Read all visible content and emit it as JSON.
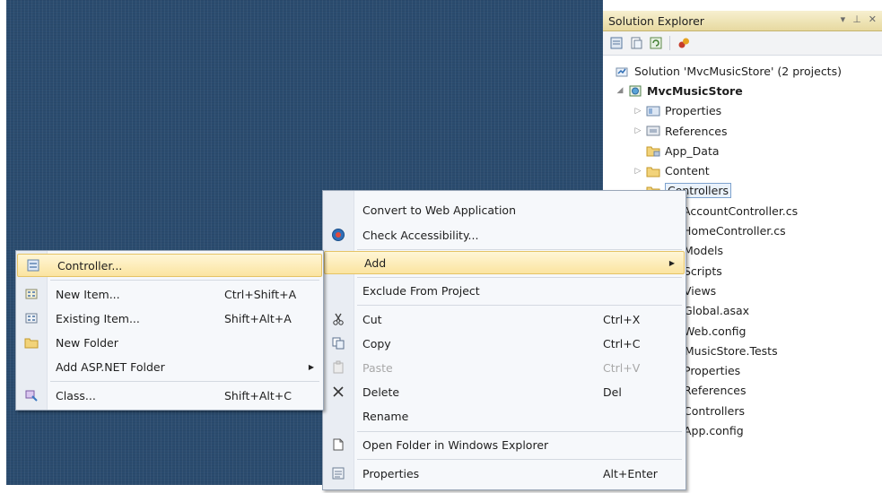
{
  "solution_explorer": {
    "title": "Solution Explorer",
    "title_controls": [
      "▾",
      "⊥",
      "✕"
    ],
    "tree": [
      {
        "label": "Solution 'MvcMusicStore' (2 projects)",
        "icon": "solution-icon"
      },
      {
        "label": "MvcMusicStore",
        "icon": "web-project-icon"
      },
      {
        "label": "Properties",
        "icon": "properties-icon"
      },
      {
        "label": "References",
        "icon": "references-icon"
      },
      {
        "label": "App_Data",
        "icon": "folder-icon"
      },
      {
        "label": "Content",
        "icon": "folder-icon"
      },
      {
        "label": "Controllers",
        "icon": "folder-icon"
      },
      {
        "label": "AccountController.cs",
        "icon": "csharp-file-icon"
      },
      {
        "label": "HomeController.cs",
        "icon": "csharp-file-icon"
      },
      {
        "label": "Models"
      },
      {
        "label": "Scripts"
      },
      {
        "label": "Views"
      },
      {
        "label": "Global.asax"
      },
      {
        "label": "Web.config"
      },
      {
        "label": "cMusicStore.Tests"
      },
      {
        "label": "Properties"
      },
      {
        "label": "References"
      },
      {
        "label": "Controllers"
      },
      {
        "label": "App.config"
      }
    ]
  },
  "context_menu": {
    "items": [
      {
        "label": "Convert to Web Application",
        "shortcut": ""
      },
      {
        "label": "Check Accessibility...",
        "shortcut": "",
        "icon": "accessibility-icon"
      },
      {
        "label": "Add",
        "shortcut": "",
        "submenu": true
      },
      {
        "label": "Exclude From Project",
        "shortcut": ""
      },
      {
        "label": "Cut",
        "shortcut": "Ctrl+X",
        "icon": "scissors-icon"
      },
      {
        "label": "Copy",
        "shortcut": "Ctrl+C",
        "icon": "copy-icon"
      },
      {
        "label": "Paste",
        "shortcut": "Ctrl+V",
        "icon": "paste-icon",
        "disabled": true
      },
      {
        "label": "Delete",
        "shortcut": "Del",
        "icon": "delete-icon"
      },
      {
        "label": "Rename",
        "shortcut": ""
      },
      {
        "label": "Open Folder in Windows Explorer",
        "shortcut": "",
        "icon": "open-folder-icon"
      },
      {
        "label": "Properties",
        "shortcut": "Alt+Enter",
        "icon": "properties-icon"
      }
    ]
  },
  "add_submenu": {
    "items": [
      {
        "label": "Controller...",
        "shortcut": "",
        "icon": "controller-icon"
      },
      {
        "label": "New Item...",
        "shortcut": "Ctrl+Shift+A",
        "icon": "new-item-icon"
      },
      {
        "label": "Existing Item...",
        "shortcut": "Shift+Alt+A",
        "icon": "existing-item-icon"
      },
      {
        "label": "New Folder",
        "shortcut": "",
        "icon": "new-folder-icon"
      },
      {
        "label": "Add ASP.NET Folder",
        "shortcut": "",
        "submenu": true
      },
      {
        "label": "Class...",
        "shortcut": "Shift+Alt+C",
        "icon": "class-icon"
      }
    ]
  },
  "colors": {
    "editor_background": "#2b4c6f",
    "menu_highlight": "#fbe4a0",
    "title_bar": "#e7d9a0"
  }
}
